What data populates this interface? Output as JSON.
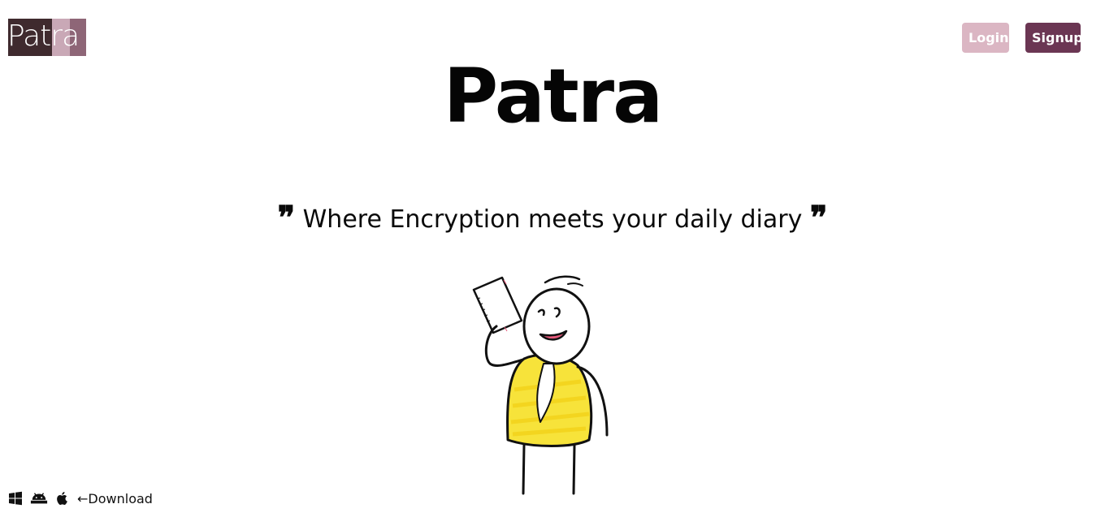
{
  "header": {
    "logo_text": "Patra",
    "login_label": "Login",
    "signup_label": "Signup"
  },
  "hero": {
    "title": "Patra",
    "tagline": "Where Encryption meets your daily diary",
    "quote_open": "❞",
    "quote_close": "❞"
  },
  "download": {
    "icons": [
      "windows-icon",
      "android-icon",
      "apple-icon"
    ],
    "label": "←Download"
  },
  "colors": {
    "login_bg": "#dbb6c3",
    "signup_bg": "#6b3653",
    "logo_dark": "#3f2a2e",
    "logo_mid": "#c9a8b6",
    "logo_light": "#8e6677",
    "character_shirt": "#f7e33a",
    "character_mouth": "#e75a7c"
  }
}
